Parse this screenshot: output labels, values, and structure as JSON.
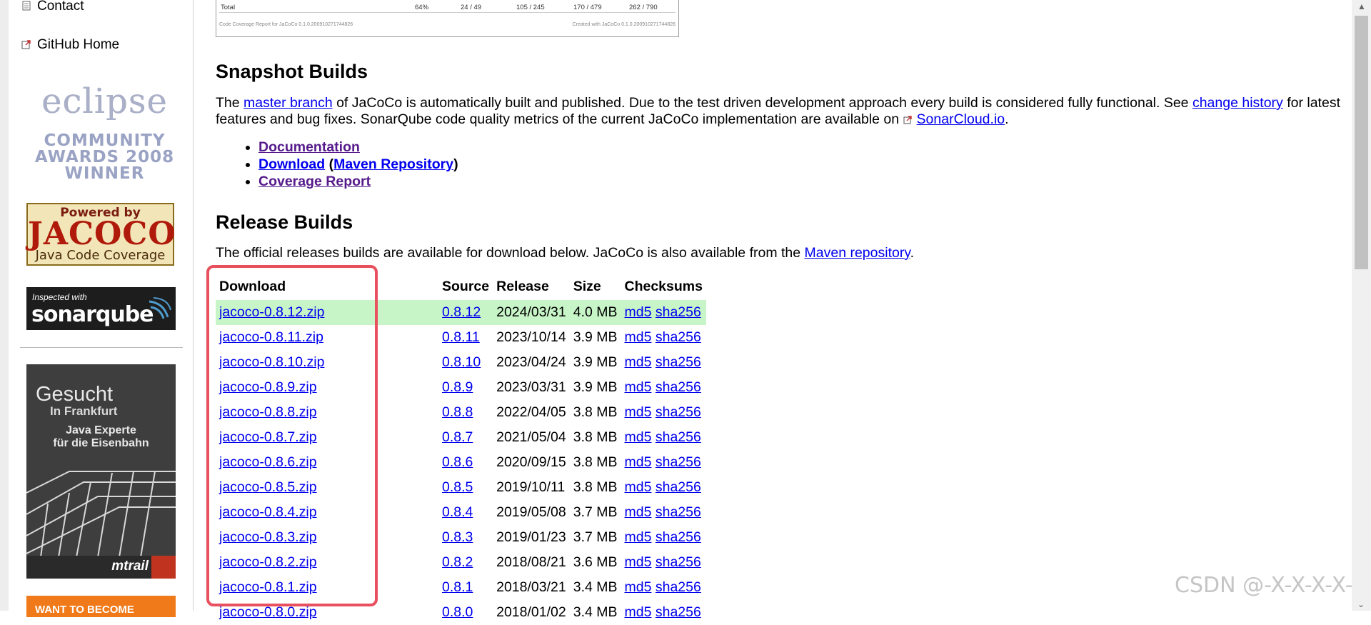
{
  "sidebar": {
    "contact_label": "Contact",
    "github_label": "GitHub Home",
    "eclipse_badge": {
      "word": "eclipse",
      "line1": "COMMUNITY",
      "line2": "AWARDS 2008",
      "line3": "WINNER"
    },
    "jacoco_badge": {
      "powered": "Powered by",
      "name": "JACOCO",
      "sub": "Java Code Coverage"
    },
    "sonar_badge": {
      "inspected": "Inspected with",
      "name": "sonarqube"
    },
    "ad": {
      "gesucht": "Gesucht",
      "frankfurt": "In Frankfurt",
      "line1": "Java Experte",
      "line2": "für die Eisenbahn",
      "logo": "mtrail"
    },
    "orange_ad_text": "WANT TO BECOME"
  },
  "coverage_snippet": {
    "total_label": "Total",
    "pct": "64%",
    "v1": "24 /   49",
    "v2": "105 /   245",
    "v3": "170 /   479",
    "v4": "262 /  790",
    "footer_left": "Code Coverage Report for JaCoCo 0.1.0.200910271744826",
    "footer_right": "Created with JaCoCo 0.1.0.200910271744826"
  },
  "snapshot": {
    "heading": "Snapshot Builds",
    "p_1": "The ",
    "master_branch": "master branch",
    "p_2": " of JaCoCo is automatically built and published. Due to the test driven development approach every build is considered fully functional. See ",
    "change_history": "change history",
    "p_3": " for latest features and bug fixes. SonarQube code quality metrics of the current JaCoCo implementation are available on ",
    "sonarcloud": "SonarCloud.io",
    "p_4": ".",
    "links": {
      "documentation": "Documentation",
      "download": "Download",
      "open_paren": " (",
      "maven_repository": "Maven Repository",
      "close_paren": ")",
      "coverage_report": "Coverage Report"
    }
  },
  "release": {
    "heading": "Release Builds",
    "intro_1": "The official releases builds are available for download below. JaCoCo is also available from the ",
    "maven_link": "Maven repository",
    "intro_2": ".",
    "columns": {
      "download": "Download",
      "source": "Source",
      "release": "Release",
      "size": "Size",
      "checksums": "Checksums"
    },
    "rows": [
      {
        "file": "jacoco-0.8.12.zip",
        "source": "0.8.12",
        "date": "2024/03/31",
        "size": "4.0 MB",
        "md5": "md5",
        "sha": "sha256"
      },
      {
        "file": "jacoco-0.8.11.zip",
        "source": "0.8.11",
        "date": "2023/10/14",
        "size": "3.9 MB",
        "md5": "md5",
        "sha": "sha256"
      },
      {
        "file": "jacoco-0.8.10.zip",
        "source": "0.8.10",
        "date": "2023/04/24",
        "size": "3.9 MB",
        "md5": "md5",
        "sha": "sha256"
      },
      {
        "file": "jacoco-0.8.9.zip",
        "source": "0.8.9",
        "date": "2023/03/31",
        "size": "3.9 MB",
        "md5": "md5",
        "sha": "sha256"
      },
      {
        "file": "jacoco-0.8.8.zip",
        "source": "0.8.8",
        "date": "2022/04/05",
        "size": "3.8 MB",
        "md5": "md5",
        "sha": "sha256"
      },
      {
        "file": "jacoco-0.8.7.zip",
        "source": "0.8.7",
        "date": "2021/05/04",
        "size": "3.8 MB",
        "md5": "md5",
        "sha": "sha256"
      },
      {
        "file": "jacoco-0.8.6.zip",
        "source": "0.8.6",
        "date": "2020/09/15",
        "size": "3.8 MB",
        "md5": "md5",
        "sha": "sha256"
      },
      {
        "file": "jacoco-0.8.5.zip",
        "source": "0.8.5",
        "date": "2019/10/11",
        "size": "3.8 MB",
        "md5": "md5",
        "sha": "sha256"
      },
      {
        "file": "jacoco-0.8.4.zip",
        "source": "0.8.4",
        "date": "2019/05/08",
        "size": "3.7 MB",
        "md5": "md5",
        "sha": "sha256"
      },
      {
        "file": "jacoco-0.8.3.zip",
        "source": "0.8.3",
        "date": "2019/01/23",
        "size": "3.7 MB",
        "md5": "md5",
        "sha": "sha256"
      },
      {
        "file": "jacoco-0.8.2.zip",
        "source": "0.8.2",
        "date": "2018/08/21",
        "size": "3.6 MB",
        "md5": "md5",
        "sha": "sha256"
      },
      {
        "file": "jacoco-0.8.1.zip",
        "source": "0.8.1",
        "date": "2018/03/21",
        "size": "3.4 MB",
        "md5": "md5",
        "sha": "sha256"
      },
      {
        "file": "jacoco-0.8.0.zip",
        "source": "0.8.0",
        "date": "2018/01/02",
        "size": "3.4 MB",
        "md5": "md5",
        "sha": "sha256"
      }
    ]
  },
  "watermark": "CSDN @-X-X-X-X-",
  "colors": {
    "link": "#0000ee",
    "visited": "#551a8b",
    "highlight_row": "#c8f5c8",
    "annotation_box": "#e8505e"
  }
}
